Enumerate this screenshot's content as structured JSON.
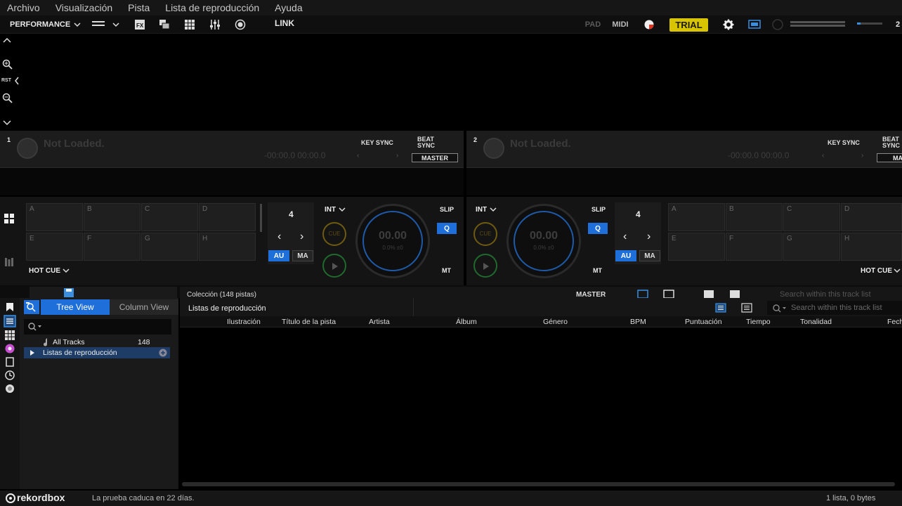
{
  "menu": [
    "Archivo",
    "Visualización",
    "Pista",
    "Lista de reproducción",
    "Ayuda"
  ],
  "toolbar": {
    "mode": "PERFORMANCE",
    "link": "LINK",
    "pad": "PAD",
    "midi": "MIDI",
    "trial": "TRIAL",
    "deck_count": "2",
    "accent": "#1e6fd9",
    "trial_color": "#d9c400"
  },
  "zoom": {
    "reset": "RST"
  },
  "deck1": {
    "number": "1",
    "status": "Not Loaded.",
    "time": "-00:00.0  00:00.0",
    "key_sync": "KEY SYNC",
    "beat_sync": "BEAT SYNC",
    "master": "MASTER",
    "pads_top": [
      "A",
      "B",
      "C",
      "D"
    ],
    "pads_bottom": [
      "E",
      "F",
      "G",
      "H"
    ],
    "pad_mode": "HOT CUE",
    "beat_count": "4",
    "auto": "AU",
    "manual": "MA",
    "int": "INT",
    "cue": "CUE",
    "slip": "SLIP",
    "quantize": "Q",
    "mt": "MT",
    "jog_bpm": "00.00",
    "jog_pitch": "0.0% ±0"
  },
  "deck2": {
    "number": "2",
    "status": "Not Loaded.",
    "time": "-00:00.0  00:00.0",
    "key_sync": "KEY SYNC",
    "beat_sync": "BEAT SYNC",
    "master": "MAST",
    "pads_top": [
      "A",
      "B",
      "C",
      "D"
    ],
    "pads_bottom": [
      "E",
      "F",
      "G",
      "H"
    ],
    "pad_mode": "HOT CUE",
    "beat_count": "4",
    "auto": "AU",
    "manual": "MA",
    "int": "INT",
    "cue": "CUE",
    "slip": "SLIP",
    "quantize": "Q",
    "mt": "MT",
    "jog_bpm": "00.00",
    "jog_pitch": "0.0% ±0"
  },
  "browser_top": {
    "collection": "Colección (148 pistas)",
    "master": "MASTER",
    "search_placeholder": "Search within this track list"
  },
  "tree": {
    "tab_tree": "Tree View",
    "tab_column": "Column View",
    "items": [
      {
        "label": "All Tracks",
        "count": "148"
      },
      {
        "label": "Listas de reproducción"
      }
    ]
  },
  "list": {
    "title": "Listas de reproducción",
    "search_placeholder": "Search within this track list",
    "columns": [
      "Ilustración",
      "Título de la pista",
      "Artista",
      "Álbum",
      "Género",
      "BPM",
      "Puntuación",
      "Tiempo",
      "Tonalidad",
      "Fech"
    ]
  },
  "status": {
    "brand": "rekordbox",
    "trial_msg": "La prueba caduca en 22 días.",
    "summary": "1 lista, 0 bytes"
  }
}
